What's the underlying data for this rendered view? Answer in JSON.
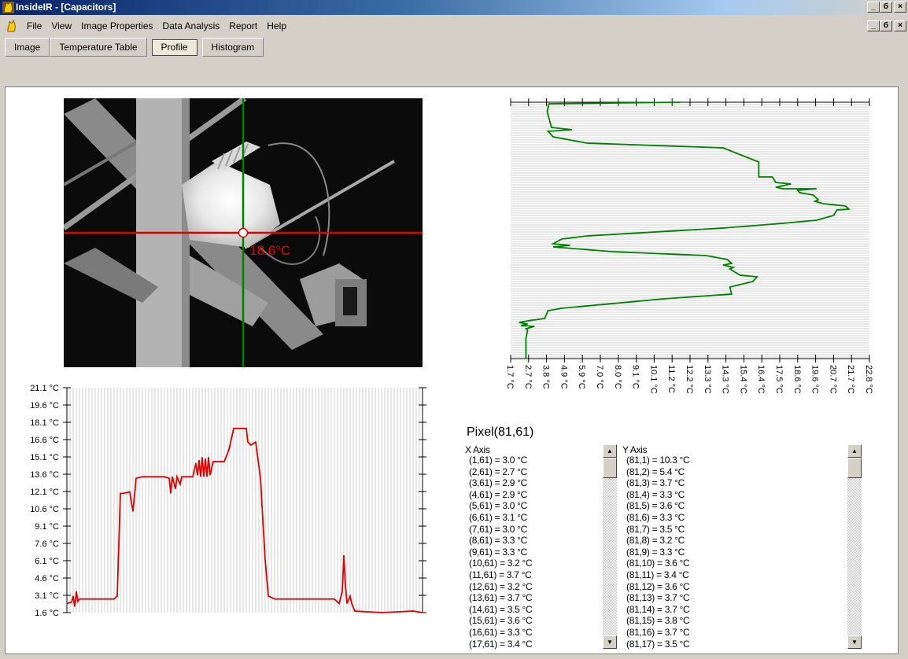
{
  "window": {
    "title": "InsideIR - [Capacitors]",
    "min_glyph": "_",
    "max_glyph": "б",
    "close_glyph": "×"
  },
  "menu": [
    "File",
    "View",
    "Image Properties",
    "Data Analysis",
    "Report",
    "Help"
  ],
  "tabs": [
    "Image",
    "Temperature Table",
    "Profile",
    "Histogram"
  ],
  "active_tab": "Profile",
  "thermal_image": {
    "cursor_temp": "18.6°C"
  },
  "vertical_profile": {
    "ticks": [
      "1.7 °C",
      "2.7 °C",
      "3.8 °C",
      "4.9 °C",
      "5.9 °C",
      "7.0 °C",
      "8.0 °C",
      "9.1 °C",
      "10.1 °C",
      "11.2 °C",
      "12.2 °C",
      "13.3 °C",
      "14.3 °C",
      "15.4 °C",
      "16.4 °C",
      "17.5 °C",
      "18.6 °C",
      "19.6 °C",
      "20.7 °C",
      "21.7 °C",
      "22.8 °C"
    ]
  },
  "horizontal_profile": {
    "ticks": [
      "21.1 °C",
      "19.6 °C",
      "18.1 °C",
      "16.6 °C",
      "15.1 °C",
      "13.6 °C",
      "12.1 °C",
      "10.6 °C",
      "9.1 °C",
      "7.6 °C",
      "6.1 °C",
      "4.6 °C",
      "3.1 °C",
      "1.6 °C"
    ]
  },
  "pixel": {
    "title": "Pixel(81,61)",
    "x_header": "X Axis",
    "y_header": "Y Axis",
    "x_values": [
      "(1,61) = 3.0 °C",
      "(2,61) = 2.7 °C",
      "(3,61) = 2.9 °C",
      "(4,61) = 2.9 °C",
      "(5,61) = 3.0 °C",
      "(6,61) = 3.1 °C",
      "(7,61) = 3.0 °C",
      "(8,61) = 3.3 °C",
      "(9,61) = 3.3 °C",
      "(10,61) = 3.2 °C",
      "(11,61) = 3.7 °C",
      "(12,61) = 3.2 °C",
      "(13,61) = 3.7 °C",
      "(14,61) = 3.5 °C",
      "(15,61) = 3.6 °C",
      "(16,61) = 3.3 °C",
      "(17,61) = 3.4 °C"
    ],
    "y_values": [
      "(81,1) = 10.3 °C",
      "(81,2) = 5.4 °C",
      "(81,3) = 3.7 °C",
      "(81,4) = 3.3 °C",
      "(81,5) = 3.6 °C",
      "(81,6) = 3.3 °C",
      "(81,7) = 3.5 °C",
      "(81,8) = 3.2 °C",
      "(81,9) = 3.3 °C",
      "(81,10) = 3.6 °C",
      "(81,11) = 3.4 °C",
      "(81,12) = 3.6 °C",
      "(81,13) = 3.7 °C",
      "(81,14) = 3.7 °C",
      "(81,15) = 3.8 °C",
      "(81,16) = 3.7 °C",
      "(81,17) = 3.5 °C"
    ]
  },
  "colors": {
    "horizontal_line": "#e00000",
    "vertical_line": "#008000",
    "title_bar": "#0a246a"
  },
  "icons": {
    "app": "flame-app-icon",
    "scroll_up": "arrow-up-icon",
    "scroll_down": "arrow-down-icon"
  }
}
